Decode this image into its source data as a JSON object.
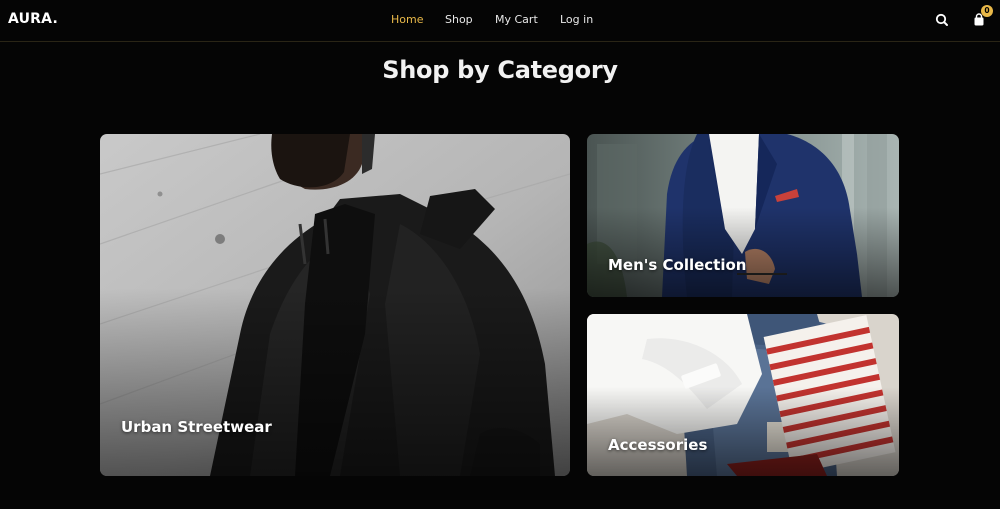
{
  "brand": {
    "logo": "AURA."
  },
  "nav": {
    "home": "Home",
    "shop": "Shop",
    "cart": "My Cart",
    "login": "Log in"
  },
  "header": {
    "cart_count": "0"
  },
  "colors": {
    "accent": "#e9b949",
    "background": "#050505"
  },
  "icons": {
    "search": "search-icon",
    "cart": "shopping-bag-icon"
  },
  "categories": {
    "title": "Shop by Category",
    "items": [
      {
        "label": "Urban Streetwear"
      },
      {
        "label": "Men's Collection"
      },
      {
        "label": "Accessories"
      }
    ]
  }
}
